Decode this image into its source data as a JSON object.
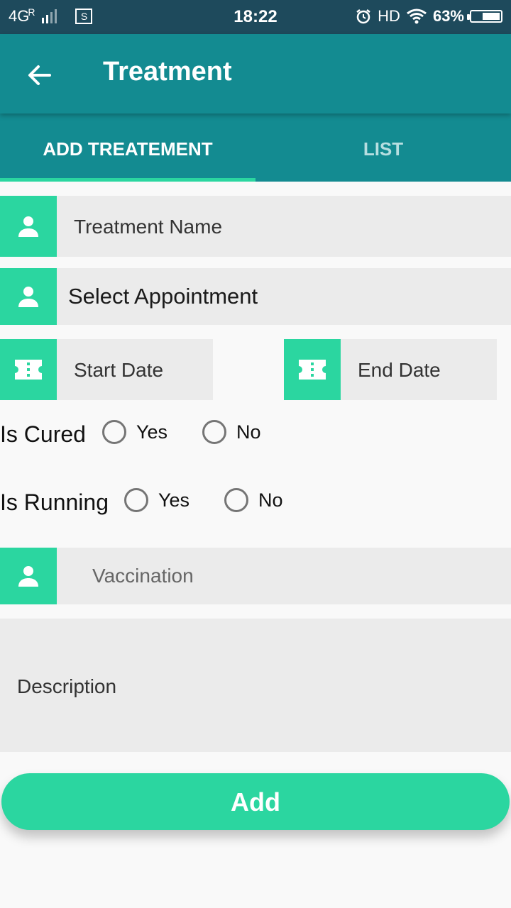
{
  "statusbar": {
    "network": "4G",
    "roaming": "R",
    "sim_icon_label": "S",
    "time": "18:22",
    "hd": "HD",
    "battery": "63%",
    "battery_level": 0.63
  },
  "appbar": {
    "title": "Treatment"
  },
  "tabs": [
    {
      "label": "ADD TREATEMENT",
      "active": true
    },
    {
      "label": "LIST",
      "active": false
    }
  ],
  "form": {
    "treatment_name_placeholder": "Treatment Name",
    "select_appointment": "Select Appointment",
    "start_date_placeholder": "Start Date",
    "end_date_placeholder": "End Date",
    "is_cured": {
      "label": "Is Cured",
      "yes": "Yes",
      "no": "No"
    },
    "is_running": {
      "label": "Is Running",
      "yes": "Yes",
      "no": "No"
    },
    "vaccination_placeholder": "Vaccination",
    "description_placeholder": "Description",
    "add_button": "Add"
  },
  "colors": {
    "statusbar": "#1e4a5c",
    "primary": "#138b91",
    "accent": "#2bd6a0",
    "field_bg": "#ebebeb"
  }
}
